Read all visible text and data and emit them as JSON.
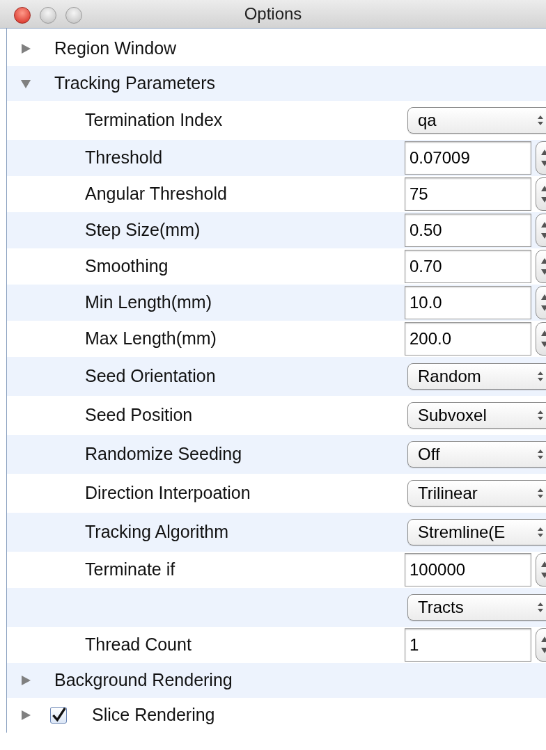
{
  "window": {
    "title": "Options"
  },
  "sections": [
    {
      "label": "Region Window",
      "expanded": false
    },
    {
      "label": "Tracking Parameters",
      "expanded": true,
      "children": [
        {
          "kind": "combo",
          "label": "Termination Index",
          "value": "qa"
        },
        {
          "kind": "spin",
          "label": "Threshold",
          "value": "0.07009"
        },
        {
          "kind": "spin",
          "label": "Angular Threshold",
          "value": "75"
        },
        {
          "kind": "spin",
          "label": "Step Size(mm)",
          "value": "0.50"
        },
        {
          "kind": "spin",
          "label": "Smoothing",
          "value": "0.70"
        },
        {
          "kind": "spin",
          "label": "Min Length(mm)",
          "value": "10.0"
        },
        {
          "kind": "spin",
          "label": "Max Length(mm)",
          "value": "200.0"
        },
        {
          "kind": "combo",
          "label": "Seed Orientation",
          "value": "Random"
        },
        {
          "kind": "combo",
          "label": "Seed Position",
          "value": "Subvoxel"
        },
        {
          "kind": "combo",
          "label": "Randomize Seeding",
          "value": "Off"
        },
        {
          "kind": "combo",
          "label": "Direction Interpoation",
          "value": "Trilinear"
        },
        {
          "kind": "combo",
          "label": "Tracking Algorithm",
          "value": "Stremline(E"
        },
        {
          "kind": "spin",
          "label": "Terminate if",
          "value": "100000"
        },
        {
          "kind": "combo",
          "value": "Tracts"
        },
        {
          "kind": "spin",
          "label": "Thread Count",
          "value": "1"
        }
      ]
    },
    {
      "label": "Background Rendering",
      "expanded": false
    },
    {
      "label": "Slice Rendering",
      "expanded": false,
      "checked": true
    }
  ]
}
